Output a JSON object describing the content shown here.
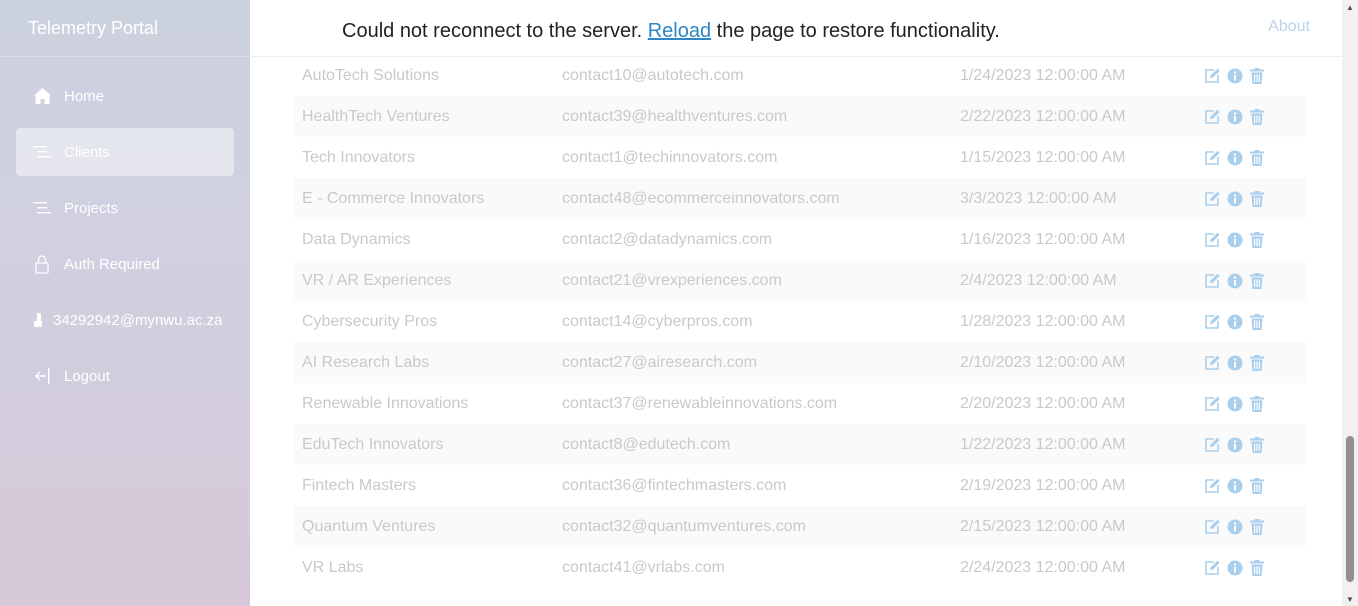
{
  "sidebar": {
    "brand": "Telemetry Portal",
    "items": [
      {
        "label": "Home",
        "icon": "home-icon",
        "active": false
      },
      {
        "label": "Clients",
        "icon": "list-icon",
        "active": true
      },
      {
        "label": "Projects",
        "icon": "list-icon",
        "active": false
      },
      {
        "label": "Auth Required",
        "icon": "lock-icon",
        "active": false
      },
      {
        "label": "34292942@mynwu.ac.za",
        "icon": "user-icon",
        "active": false
      },
      {
        "label": "Logout",
        "icon": "logout-icon",
        "active": false
      }
    ]
  },
  "header": {
    "about": "About"
  },
  "banner": {
    "before": "Could not reconnect to the server. ",
    "link": "Reload",
    "after": " the page to restore functionality."
  },
  "table": {
    "rows": [
      {
        "name": "AutoTech Solutions",
        "email": "contact10@autotech.com",
        "date": "1/24/2023 12:00:00 AM"
      },
      {
        "name": "HealthTech Ventures",
        "email": "contact39@healthventures.com",
        "date": "2/22/2023 12:00:00 AM"
      },
      {
        "name": "Tech Innovators",
        "email": "contact1@techinnovators.com",
        "date": "1/15/2023 12:00:00 AM"
      },
      {
        "name": "E - Commerce Innovators",
        "email": "contact48@ecommerceinnovators.com",
        "date": "3/3/2023 12:00:00 AM"
      },
      {
        "name": "Data Dynamics",
        "email": "contact2@datadynamics.com",
        "date": "1/16/2023 12:00:00 AM"
      },
      {
        "name": "VR / AR Experiences",
        "email": "contact21@vrexperiences.com",
        "date": "2/4/2023 12:00:00 AM"
      },
      {
        "name": "Cybersecurity Pros",
        "email": "contact14@cyberpros.com",
        "date": "1/28/2023 12:00:00 AM"
      },
      {
        "name": "AI Research Labs",
        "email": "contact27@airesearch.com",
        "date": "2/10/2023 12:00:00 AM"
      },
      {
        "name": "Renewable Innovations",
        "email": "contact37@renewableinnovations.com",
        "date": "2/20/2023 12:00:00 AM"
      },
      {
        "name": "EduTech Innovators",
        "email": "contact8@edutech.com",
        "date": "1/22/2023 12:00:00 AM"
      },
      {
        "name": "Fintech Masters",
        "email": "contact36@fintechmasters.com",
        "date": "2/19/2023 12:00:00 AM"
      },
      {
        "name": "Quantum Ventures",
        "email": "contact32@quantumventures.com",
        "date": "2/15/2023 12:00:00 AM"
      },
      {
        "name": "VR Labs",
        "email": "contact41@vrlabs.com",
        "date": "2/24/2023 12:00:00 AM"
      }
    ],
    "actions": [
      "edit-icon",
      "info-icon",
      "trash-icon"
    ]
  },
  "colors": {
    "accent": "#2f86c4",
    "action_icon": "#a9cfec",
    "muted_text": "#c9c9c9",
    "sidebar_top": "#ccd1de",
    "sidebar_bottom": "#d6c8d8"
  }
}
